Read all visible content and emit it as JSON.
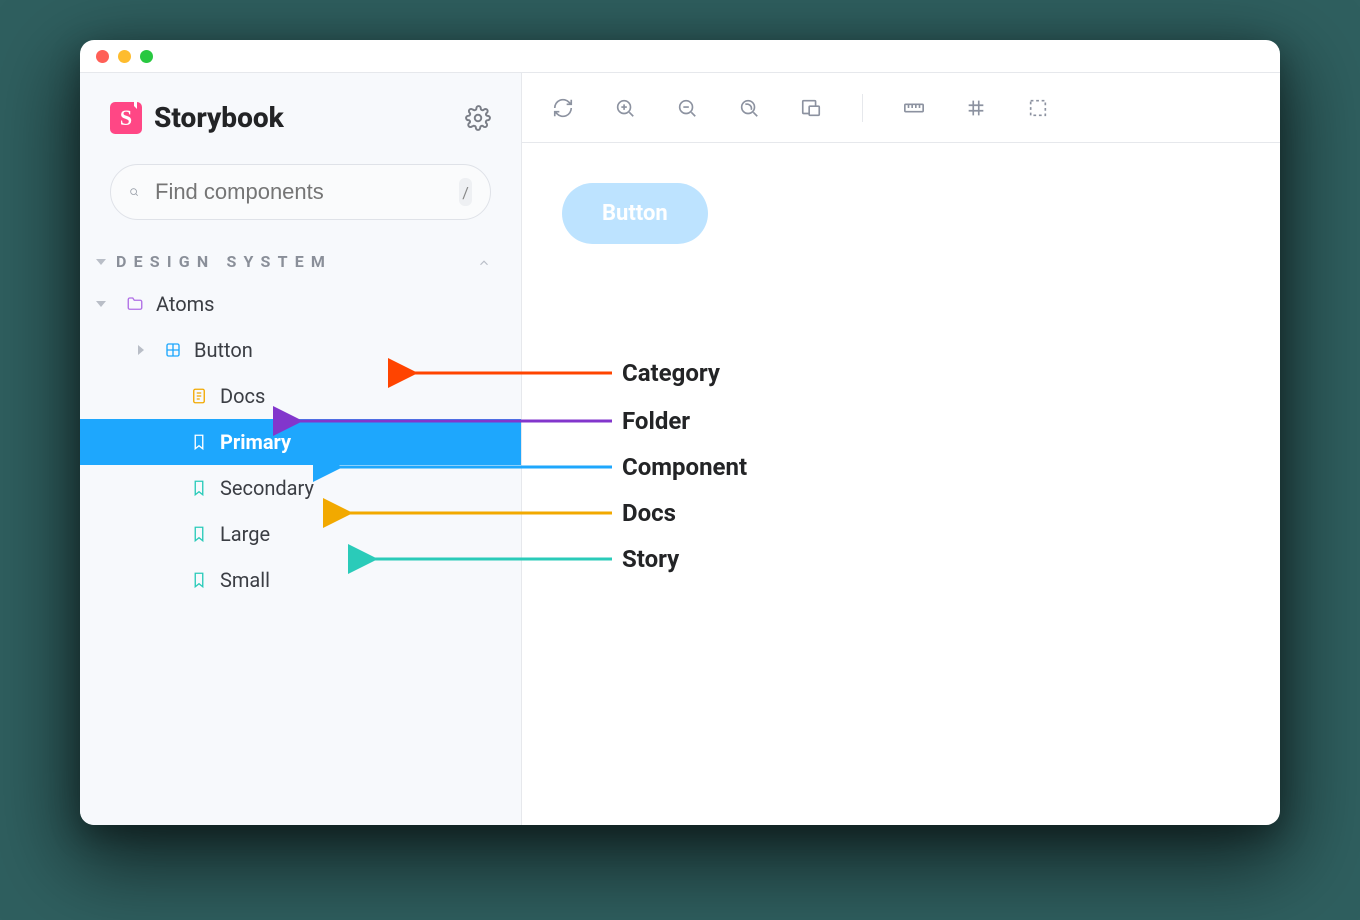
{
  "brand": {
    "title": "Storybook",
    "logo_letter": "S"
  },
  "search": {
    "placeholder": "Find components",
    "shortcut": "/"
  },
  "sidebar": {
    "category": "DESIGN SYSTEM",
    "folder": "Atoms",
    "component": "Button",
    "docs": "Docs",
    "stories": {
      "primary": "Primary",
      "secondary": "Secondary",
      "large": "Large",
      "small": "Small"
    }
  },
  "preview": {
    "button_label": "Button"
  },
  "annotations": {
    "category": "Category",
    "folder": "Folder",
    "component": "Component",
    "docs": "Docs",
    "story": "Story",
    "colors": {
      "category": "#ff4400",
      "folder": "#8236cc",
      "component": "#1ea7fd",
      "docs": "#f2a900",
      "story": "#2acbb9"
    }
  }
}
